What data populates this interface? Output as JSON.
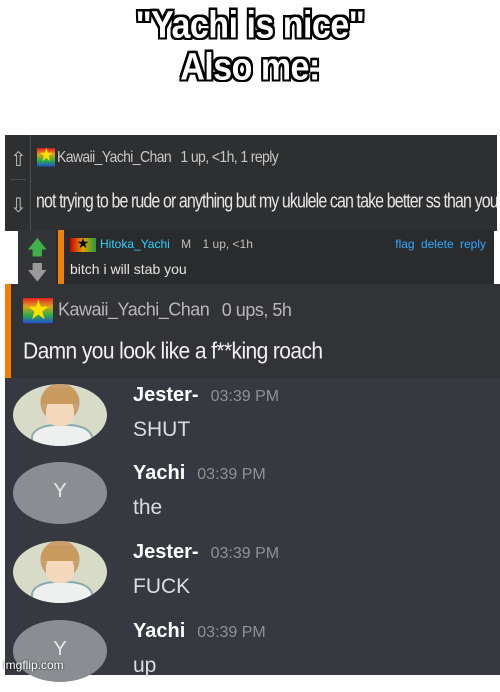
{
  "caption": {
    "line1": "\"Yachi is nice\"",
    "line2": "Also me:"
  },
  "comment1": {
    "username": "Kawaii_Yachi_Chan",
    "meta": "1 up, <1h, 1 reply",
    "body": "not trying to be rude or anything but my ukulele can take better ss than you..."
  },
  "comment2": {
    "username": "Hitoka_Yachi",
    "gender": "M",
    "meta": "1 up, <1h",
    "actions": [
      "flag",
      "delete",
      "reply"
    ],
    "body": "bitch i will stab you"
  },
  "comment3": {
    "username": "Kawaii_Yachi_Chan",
    "meta": "0 ups, 5h",
    "body": "Damn you look like a f**king roach"
  },
  "chat": {
    "messages": [
      {
        "user": "Jester-",
        "time": "03:39 PM",
        "text": "SHUT",
        "avatar_letter": ""
      },
      {
        "user": "Yachi",
        "time": "03:39 PM",
        "text": "the",
        "avatar_letter": "Y"
      },
      {
        "user": "Jester-",
        "time": "03:39 PM",
        "text": "FUCK",
        "avatar_letter": ""
      },
      {
        "user": "Yachi",
        "time": "03:39 PM",
        "text": "up",
        "avatar_letter": "Y"
      }
    ]
  },
  "watermark": "imgflip.com",
  "colors": {
    "accent_orange": "#f08000",
    "link_blue": "#33a9ff",
    "upvote_green": "#3fb04a",
    "chat_bg": "#36393f"
  }
}
